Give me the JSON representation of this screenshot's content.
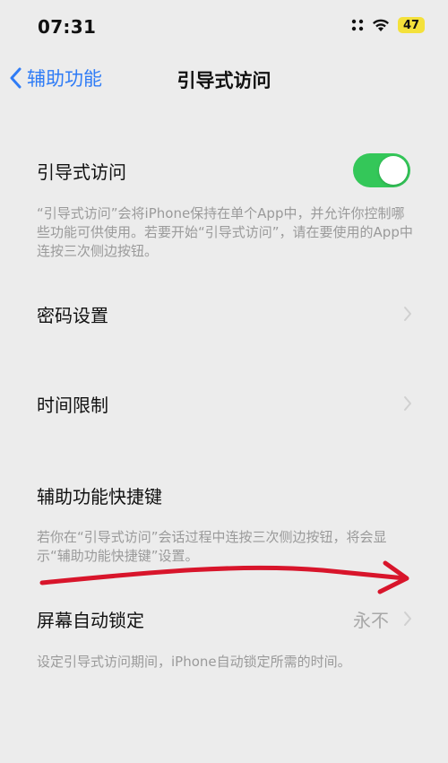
{
  "status_bar": {
    "time": "07:31",
    "battery_level": "47",
    "battery_color": "#f4e13b"
  },
  "nav": {
    "back_label": "辅助功能",
    "title": "引导式访问"
  },
  "guided_access": {
    "label": "引导式访问",
    "enabled": true,
    "description": "“引导式访问”会将iPhone保持在单个App中，并允许你控制哪些功能可供使用。若要开始“引导式访问”，请在要使用的App中连按三次侧边按钮。"
  },
  "passcode_settings": {
    "label": "密码设置"
  },
  "time_limits": {
    "label": "时间限制"
  },
  "accessibility_shortcut": {
    "label": "辅助功能快捷键",
    "description": "若你在“引导式访问”会话过程中连按三次侧边按钮，将会显示“辅助功能快捷键”设置。"
  },
  "display_auto_lock": {
    "label": "屏幕自动锁定",
    "value": "永不",
    "description": "设定引导式访问期间，iPhone自动锁定所需的时间。"
  },
  "colors": {
    "accent": "#2f7cf6",
    "toggle_on": "#34c759",
    "annotation_arrow": "#d8152b"
  }
}
